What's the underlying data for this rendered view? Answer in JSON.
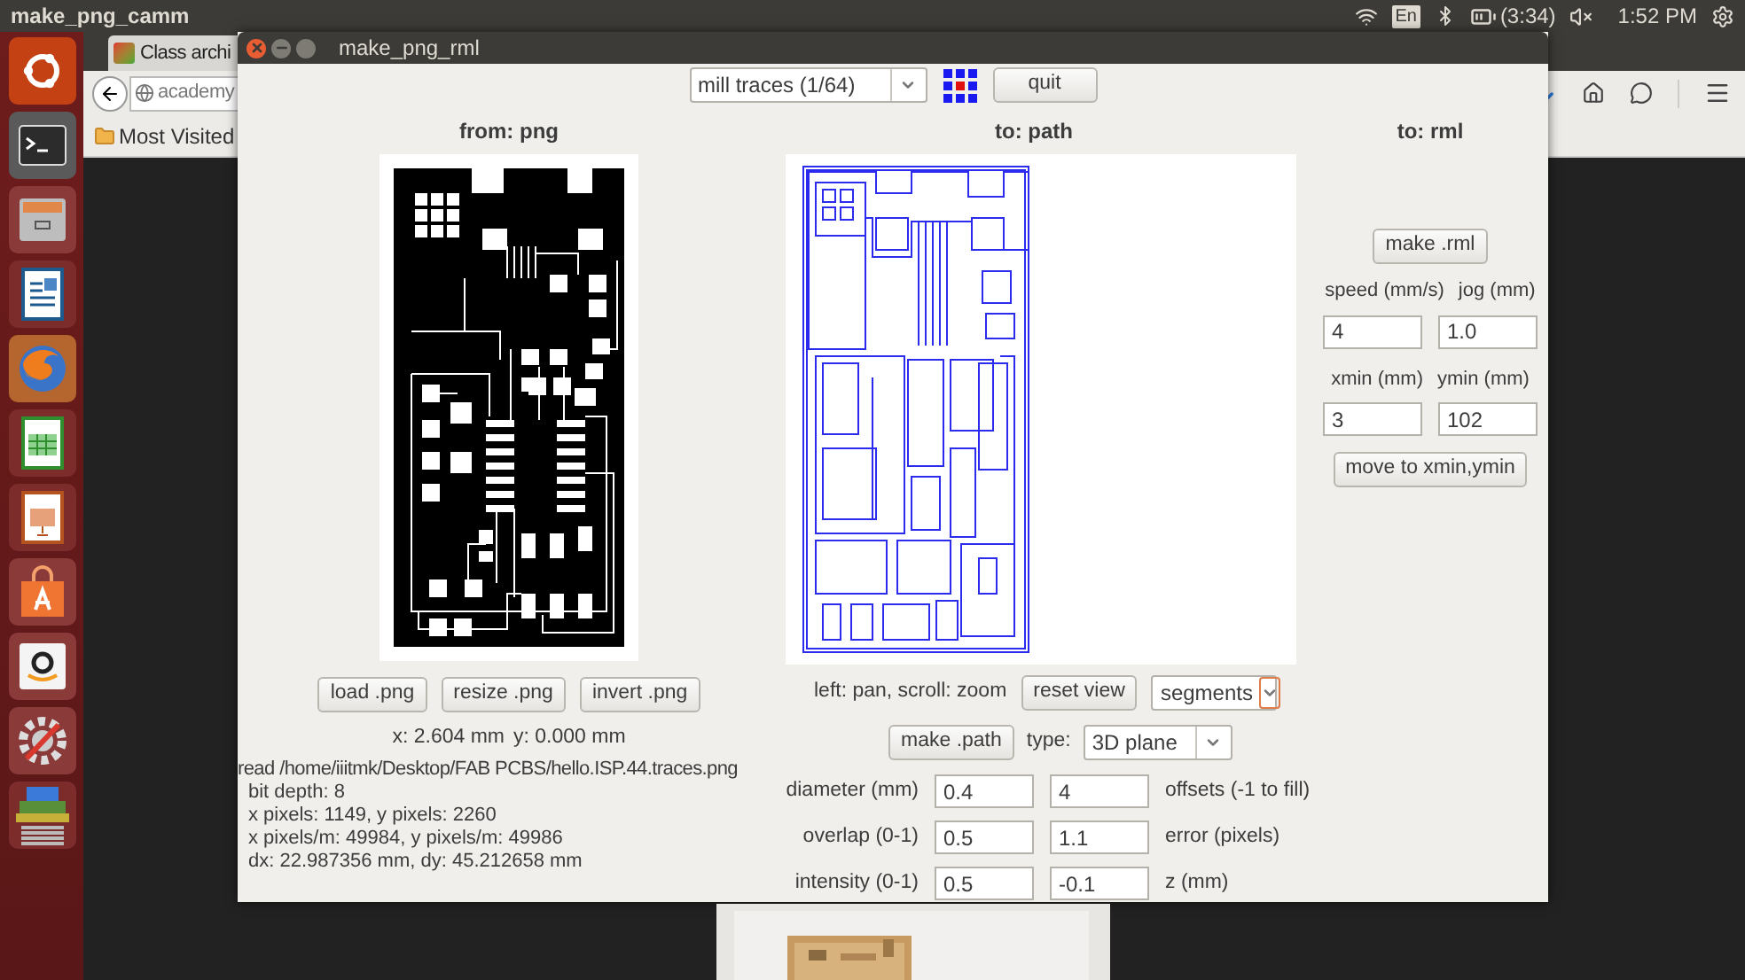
{
  "top_bar": {
    "title": "make_png_camm",
    "keyboard": "En",
    "battery": "(3:34)",
    "time": "1:52 PM"
  },
  "browser": {
    "tab": "Class archi",
    "address": "academy",
    "bookmark": "Most Visited"
  },
  "dialog": {
    "title": "make_png_rml",
    "mode_select": "mill traces (1/64)",
    "quit": "quit",
    "headings": [
      "from: png",
      "to: path",
      "to: rml"
    ],
    "png_buttons": [
      "load .png",
      "resize .png",
      "invert .png"
    ],
    "cursor": [
      "x: 2.604 mm",
      "y: 0.000 mm"
    ],
    "info": {
      "heading": "read /home/iiitmk/Desktop/FAB PCBS/hello.ISP.44.traces.png",
      "details": [
        "bit depth: 8",
        "x pixels: 1149, y pixels: 2260",
        "x pixels/m: 49984, y pixels/m: 49986",
        "dx: 22.987356 mm, dy: 45.212658 mm"
      ]
    },
    "view_hint": "left: pan, scroll: zoom",
    "reset_view": "reset view",
    "display_select": "segments",
    "make_path": "make .path",
    "type_label": "type:",
    "type_select": "3D plane",
    "path_params": [
      {
        "label": "diameter (mm)",
        "value": "0.4",
        "value2": "4",
        "label2": "offsets (-1 to fill)"
      },
      {
        "label": "overlap (0-1)",
        "value": "0.5",
        "value2": "1.1",
        "label2": "error (pixels)"
      },
      {
        "label": "intensity (0-1)",
        "value": "0.5",
        "value2": "-0.1",
        "label2": "z (mm)"
      }
    ],
    "make_rml": "make .rml",
    "rml_params": [
      [
        {
          "label": "speed (mm/s)",
          "value": "4"
        },
        {
          "label": "jog (mm)",
          "value": "1.0"
        }
      ],
      [
        {
          "label": "xmin (mm)",
          "value": "3"
        },
        {
          "label": "ymin (mm)",
          "value": "102"
        }
      ]
    ],
    "move_button": "move to xmin,ymin"
  }
}
